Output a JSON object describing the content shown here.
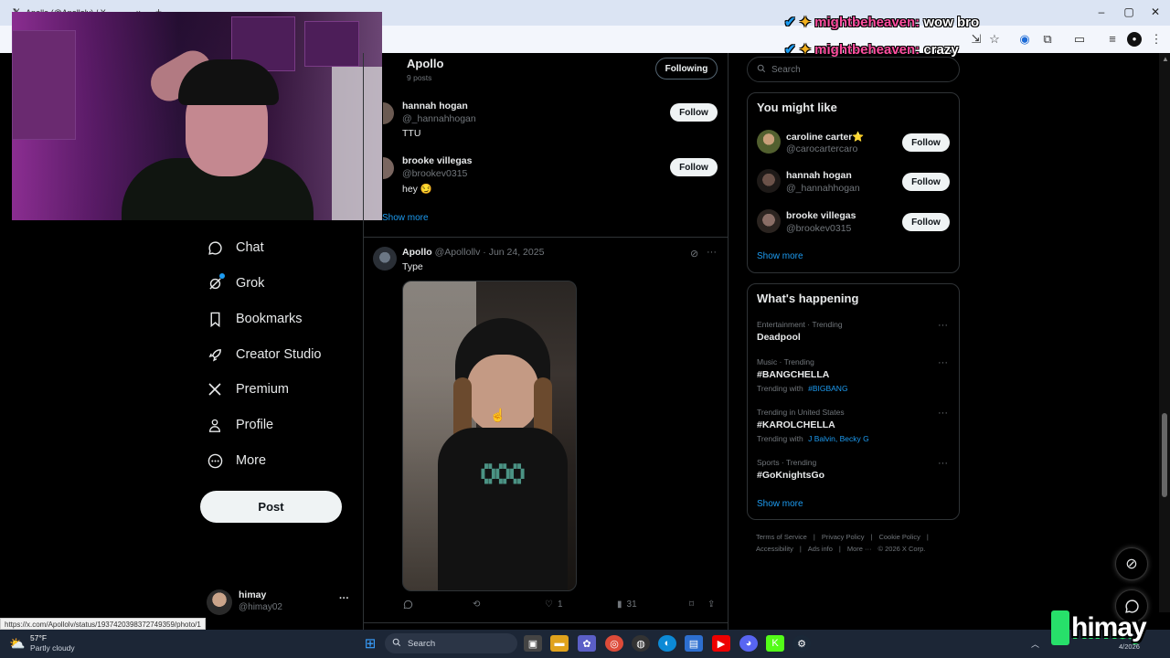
{
  "browser": {
    "tab_title": "Apollo (@Apollolv) / X",
    "status_url": "https://x.com/Apollolv/status/1937420398372749359/photo/1"
  },
  "chat_overlay": [
    {
      "user": "mightbeheaven:",
      "message": "wow bro"
    },
    {
      "user": "mightbeheaven:",
      "message": "crazy"
    }
  ],
  "nav": {
    "items": [
      {
        "label": "Chat",
        "icon": "chat-bubble-icon"
      },
      {
        "label": "Grok",
        "icon": "grok-icon"
      },
      {
        "label": "Bookmarks",
        "icon": "bookmark-icon"
      },
      {
        "label": "Creator Studio",
        "icon": "rocket-icon"
      },
      {
        "label": "Premium",
        "icon": "x-logo-icon"
      },
      {
        "label": "Profile",
        "icon": "person-icon"
      },
      {
        "label": "More",
        "icon": "more-circle-icon"
      }
    ],
    "post_label": "Post"
  },
  "account": {
    "name": "himay",
    "handle": "@himay02",
    "more": "···"
  },
  "profile_header": {
    "name": "Apollo",
    "posts": "9 posts",
    "following_label": "Following"
  },
  "who_to_follow_inline": [
    {
      "name": "hannah hogan",
      "handle": "@_hannahhogan",
      "bio": "TTU",
      "button": "Follow"
    },
    {
      "name": "brooke villegas",
      "handle": "@brookev0315",
      "bio": "hey 😏",
      "button": "Follow"
    }
  ],
  "show_more_inline": "Show more",
  "tweet": {
    "name": "Apollo",
    "handle": "@Apollollv",
    "date": "· Jun 24, 2025",
    "text": "Type",
    "actions": {
      "reply": "",
      "retweet": "",
      "likes": "1",
      "views": "31"
    }
  },
  "right": {
    "search_placeholder": "Search",
    "you_might_like": {
      "title": "You might like",
      "users": [
        {
          "name": "caroline carter⭐",
          "handle": "@carocartercaro",
          "button": "Follow"
        },
        {
          "name": "hannah hogan",
          "handle": "@_hannahhogan",
          "button": "Follow"
        },
        {
          "name": "brooke villegas",
          "handle": "@brookev0315",
          "button": "Follow"
        }
      ],
      "show_more": "Show more"
    },
    "whats_happening": {
      "title": "What's happening",
      "trends": [
        {
          "meta": "Entertainment · Trending",
          "name": "Deadpool",
          "with_label": "",
          "with": ""
        },
        {
          "meta": "Music · Trending",
          "name": "#BANGCHELLA",
          "with_label": "Trending with",
          "with": "#BIGBANG"
        },
        {
          "meta": "Trending in United States",
          "name": "#KAROLCHELLA",
          "with_label": "Trending with",
          "with": "J Balvin, Becky G"
        },
        {
          "meta": "Sports · Trending",
          "name": "#GoKnightsGo",
          "with_label": "",
          "with": ""
        }
      ],
      "show_more": "Show more"
    },
    "footer": {
      "links": [
        "Terms of Service",
        "Privacy Policy",
        "Cookie Policy",
        "Accessibility",
        "Ads info",
        "More ···"
      ],
      "copyright": "© 2026 X Corp."
    }
  },
  "taskbar": {
    "weather_temp": "57°F",
    "weather_desc": "Partly cloudy",
    "search_label": "Search",
    "date": "4/2026"
  },
  "streamer_logo": "himay",
  "colors": {
    "accent": "#1d9bf0",
    "bg": "#000000",
    "border": "#2f3336",
    "muted": "#71767b",
    "chat_user": "#ff4fa0"
  }
}
